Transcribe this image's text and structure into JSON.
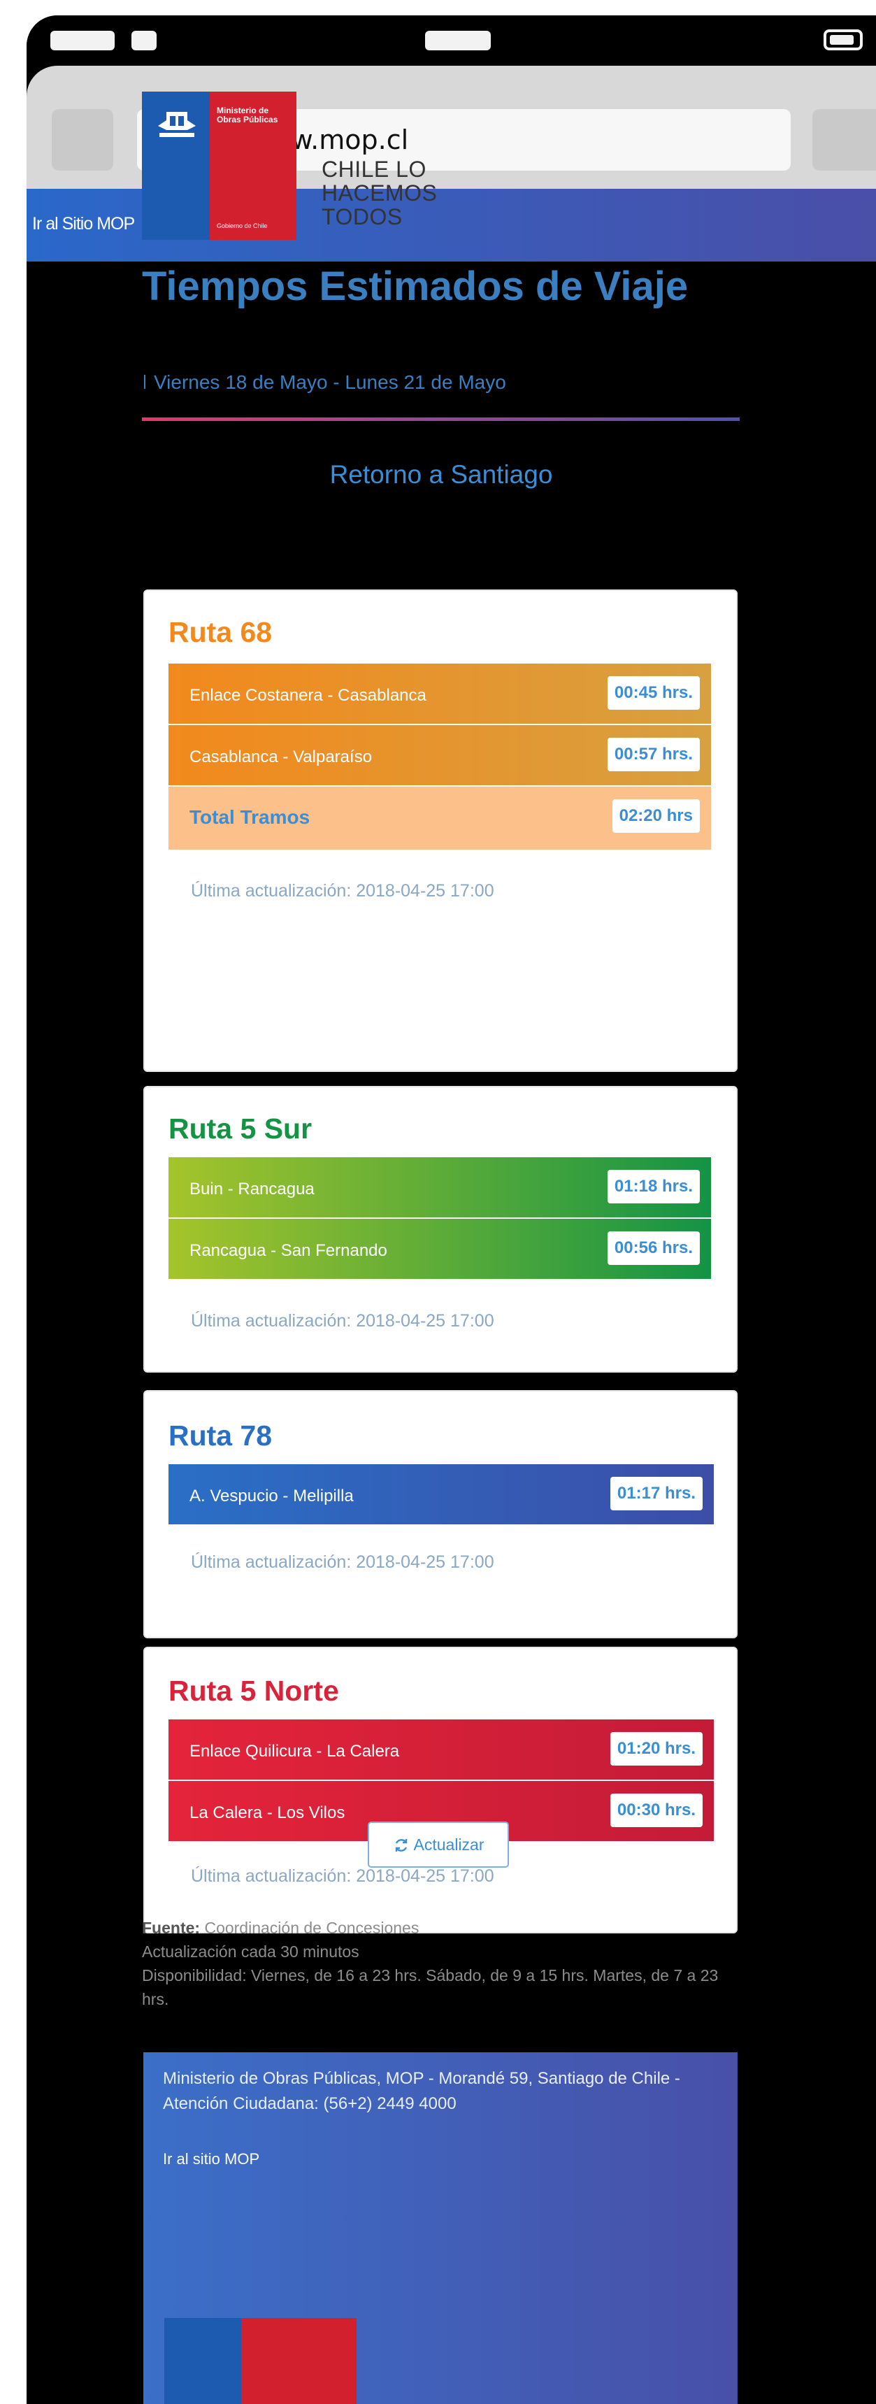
{
  "browser": {
    "url": "http://www.mop.cl"
  },
  "topbar": {
    "link": "Ir al Sitio MOP"
  },
  "logo": {
    "ministry": "Ministerio de Obras Públicas",
    "gobierno": "Gobierno de Chile",
    "slogan": "CHILE LO HACEMOS TODOS"
  },
  "page": {
    "title": "Tiempos Estimados de Viaje",
    "dates": "Viernes 18 de Mayo - Lunes 21 de Mayo",
    "section": "Retorno a Santiago"
  },
  "routes": [
    {
      "name": "Ruta 68",
      "color": "#f2891c",
      "segments": [
        {
          "name": "Enlace Costanera - Casablanca",
          "time": "00:45 hrs."
        },
        {
          "name": "Casablanca - Valparaíso",
          "time": "00:57 hrs."
        }
      ],
      "total": {
        "label": "Total Tramos",
        "time": "02:20 hrs"
      },
      "updated": "Última actualización: 2018-04-25 17:00"
    },
    {
      "name": "Ruta 5 Sur",
      "color": "#149345",
      "segments": [
        {
          "name": "Buin - Rancagua",
          "time": "01:18 hrs."
        },
        {
          "name": "Rancagua - San Fernando",
          "time": "00:56 hrs."
        }
      ],
      "updated": "Última actualización: 2018-04-25 17:00"
    },
    {
      "name": "Ruta 78",
      "color": "#2a6fc6",
      "segments": [
        {
          "name": "A. Vespucio - Melipilla",
          "time": "01:17 hrs."
        }
      ],
      "updated": "Última actualización: 2018-04-25 17:00"
    },
    {
      "name": "Ruta 5 Norte",
      "color": "#d9233a",
      "segments": [
        {
          "name": "Enlace Quilicura - La Calera",
          "time": "01:20 hrs."
        },
        {
          "name": "La Calera - Los Vilos",
          "time": "00:30 hrs."
        }
      ],
      "updated": "Última actualización: 2018-04-25 17:00"
    }
  ],
  "actions": {
    "refresh_label": "Actualizar"
  },
  "info": {
    "source_label": "Fuente:",
    "source": "Coordinación de Concesiones",
    "frequency": "Actualización cada 30 minutos",
    "availability": "Disponibilidad: Viernes, de 16 a 23 hrs. Sábado, de 9 a 15 hrs. Martes, de 7 a 23 hrs."
  },
  "footer": {
    "address": "Ministerio de Obras Públicas, MOP - Morandé 59, Santiago de Chile - Atención Ciudadana: (56+2) 2449 4000",
    "link": "Ir al sitio MOP"
  }
}
